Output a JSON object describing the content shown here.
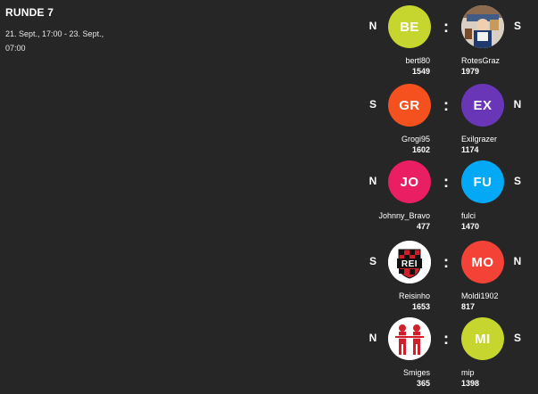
{
  "round": {
    "title": "RUNDE 7",
    "dates": "21. Sept., 17:00 - 23. Sept., 07:00"
  },
  "separator": ":",
  "matches": [
    {
      "home": {
        "initials": "BE",
        "name": "bertl80",
        "rating": "1549",
        "result": "N",
        "color": "#c6d62f"
      },
      "away": {
        "initials": "",
        "name": "RotesGraz",
        "rating": "1979",
        "result": "S",
        "color": "",
        "icon": "photo-avatar-icon"
      }
    },
    {
      "home": {
        "initials": "GR",
        "name": "Grogi95",
        "rating": "1602",
        "result": "S",
        "color": "#f4511e"
      },
      "away": {
        "initials": "EX",
        "name": "Exilgrazer",
        "rating": "1174",
        "result": "N",
        "color": "#6a36b8"
      }
    },
    {
      "home": {
        "initials": "JO",
        "name": "Johnny_Bravo",
        "rating": "477",
        "result": "N",
        "color": "#e91e63"
      },
      "away": {
        "initials": "FU",
        "name": "fulci",
        "rating": "1470",
        "result": "S",
        "color": "#03a9f4"
      }
    },
    {
      "home": {
        "initials": "REI",
        "name": "Reisinho",
        "rating": "1653",
        "result": "S",
        "color": "",
        "icon": "checkered-crest-icon"
      },
      "away": {
        "initials": "MO",
        "name": "Moldi1902",
        "rating": "817",
        "result": "N",
        "color": "#f44336"
      }
    },
    {
      "home": {
        "initials": "",
        "name": "Smiges",
        "rating": "365",
        "result": "N",
        "color": "",
        "icon": "red-silhouette-icon"
      },
      "away": {
        "initials": "MI",
        "name": "mip",
        "rating": "1398",
        "result": "S",
        "color": "#c6d62f"
      }
    }
  ]
}
